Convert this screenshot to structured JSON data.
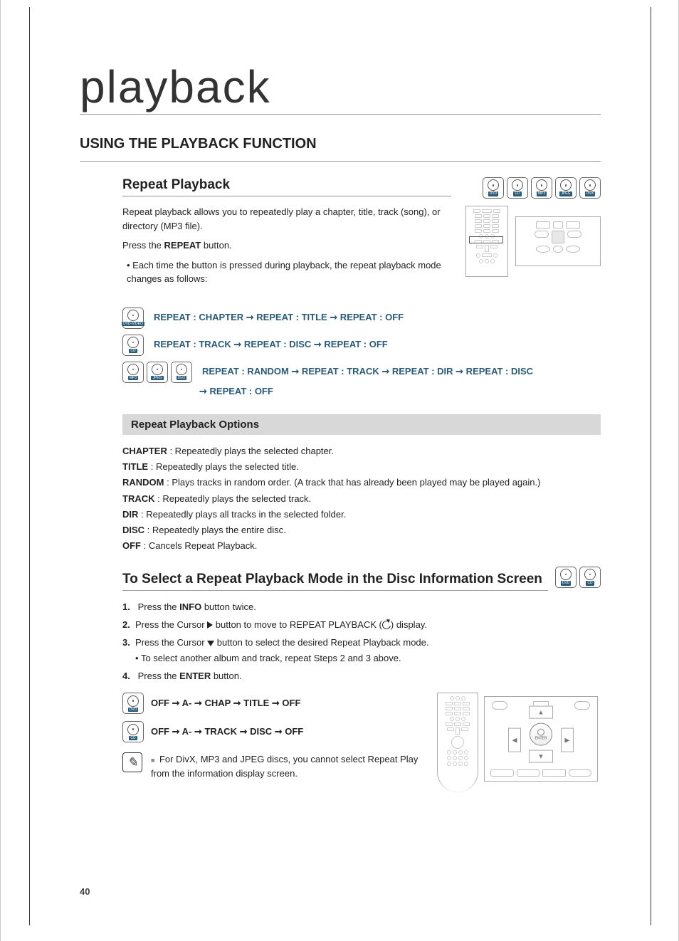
{
  "page_number": "40",
  "section_title": "playback",
  "h2": "USING THE PLAYBACK FUNCTION",
  "repeat": {
    "heading": "Repeat Playback",
    "intro": "Repeat playback allows you to repeatedly play a chapter, title, track (song), or directory (MP3 file).",
    "press": "Press the REPEAT button.",
    "press_prefix": "Press the ",
    "press_button": "REPEAT",
    "press_suffix": " button.",
    "bullet": "Each time the button is pressed during playback, the repeat playback mode changes as follows:"
  },
  "badges_top": [
    "DVD",
    "CD",
    "MP3",
    "JPEG",
    "DivX"
  ],
  "modes": [
    {
      "badges": [
        "DVD-VIDEO"
      ],
      "sequence": "REPEAT : CHAPTER ➞ REPEAT : TITLE ➞ REPEAT : OFF"
    },
    {
      "badges": [
        "CD"
      ],
      "sequence": "REPEAT : TRACK ➞ REPEAT : DISC ➞ REPEAT : OFF"
    },
    {
      "badges": [
        "MP3",
        "JPEG",
        "DivX"
      ],
      "sequence": "REPEAT : RANDOM ➞ REPEAT : TRACK ➞ REPEAT : DIR ➞ REPEAT : DISC",
      "sequence_cont": "➞ REPEAT : OFF"
    }
  ],
  "options_heading": "Repeat Playback Options",
  "options": [
    {
      "term": "CHAPTER",
      "def": " : Repeatedly plays the selected chapter."
    },
    {
      "term": "TITLE",
      "def": " : Repeatedly plays the selected title."
    },
    {
      "term": "RANDOM",
      "def": " : Plays tracks in random order. (A track that has already been played may be played again.)"
    },
    {
      "term": "TRACK",
      "def": " : Repeatedly plays the selected track."
    },
    {
      "term": "DIR",
      "def": " : Repeatedly plays all tracks in the selected folder."
    },
    {
      "term": "DISC",
      "def": " : Repeatedly plays the entire disc."
    },
    {
      "term": "OFF",
      "def": " : Cancels Repeat Playback."
    }
  ],
  "select": {
    "heading": "To Select a Repeat Playback Mode in the Disc Information Screen",
    "badges": [
      "DVD",
      "CD"
    ],
    "steps": {
      "s1_pre": "Press the ",
      "s1_b": "INFO",
      "s1_post": " button twice.",
      "s2_pre": "Press the Cursor ",
      "s2_post_a": " button to move to REPEAT PLAYBACK (",
      "s2_post_b": ") display.",
      "s3_pre": "Press the Cursor ",
      "s3_post": " button to select the desired Repeat Playback mode.",
      "s3_sub": "To select another album and track, repeat Steps 2 and 3 above.",
      "s4_pre": "Press the ",
      "s4_b": "ENTER",
      "s4_post": " button."
    }
  },
  "sequences": [
    {
      "badge": "DVD",
      "text": "OFF ➞ A- ➞ CHAP ➞ TITLE ➞ OFF"
    },
    {
      "badge": "CD",
      "text": "OFF ➞ A- ➞ TRACK ➞ DISC ➞ OFF"
    }
  ],
  "note": "For DivX, MP3 and JPEG discs, you cannot select Repeat Play from the information display screen.",
  "dpad_enter": "ENTER"
}
